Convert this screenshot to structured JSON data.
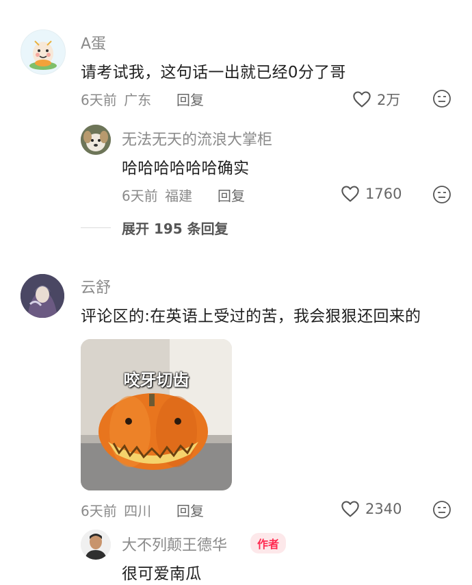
{
  "comments": [
    {
      "username": "A蛋",
      "text": "请考试我，这句话一出就已经0分了哥",
      "time": "6天前",
      "location": "广东",
      "reply_label": "回复",
      "likes": "2万",
      "replies": [
        {
          "username": "无法无天的流浪大掌柜",
          "text": "哈哈哈哈哈哈确实",
          "time": "6天前",
          "location": "福建",
          "reply_label": "回复",
          "likes": "1760"
        }
      ],
      "expand_label": "展开 195 条回复"
    },
    {
      "username": "云舒",
      "text": "评论区的:在英语上受过的苦，我会狠狠还回来的",
      "sticker_caption": "咬牙切齿",
      "time": "6天前",
      "location": "四川",
      "reply_label": "回复",
      "likes": "2340",
      "replies": [
        {
          "username": "大不列颠王德华",
          "badge": "作者",
          "text": "很可爱南瓜"
        }
      ]
    }
  ],
  "icons": {
    "like": "heart-outline-icon",
    "dislike": "meh-face-icon"
  },
  "colors": {
    "author_badge_bg": "#fde8ea",
    "author_badge_text": "#ff2a50"
  }
}
